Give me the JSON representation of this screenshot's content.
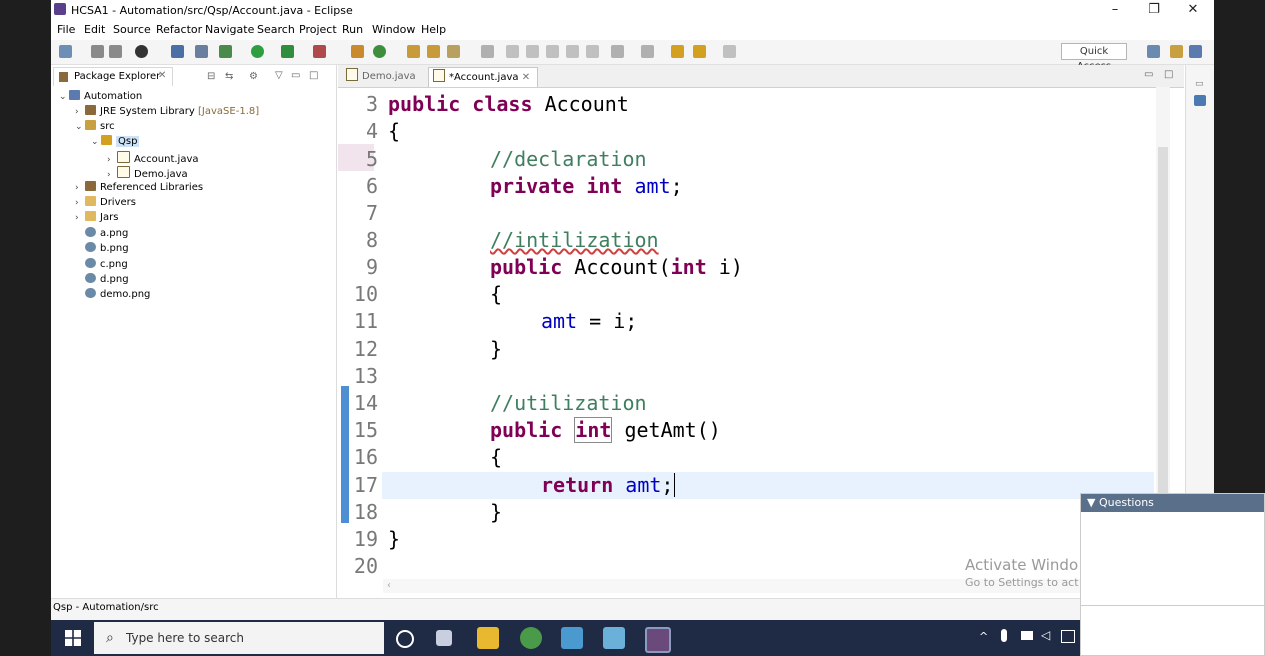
{
  "window": {
    "title": "HCSA1 - Automation/src/Qsp/Account.java - Eclipse",
    "controls": {
      "minimize": "–",
      "maximize": "❐",
      "close": "✕"
    }
  },
  "menu": [
    "File",
    "Edit",
    "Source",
    "Refactor",
    "Navigate",
    "Search",
    "Project",
    "Run",
    "Window",
    "Help"
  ],
  "toolbar": {
    "quick_access": "Quick Access"
  },
  "package_explorer": {
    "tab_label": "Package Explorer",
    "close": "✕",
    "tree": [
      {
        "label": "Automation",
        "deco": "",
        "arrow": "⌄"
      },
      {
        "label": "JRE System Library",
        "deco": "[JavaSE-1.8]",
        "arrow": "›"
      },
      {
        "label": "src",
        "deco": "",
        "arrow": "⌄"
      },
      {
        "label": "Qsp",
        "deco": "",
        "arrow": "⌄"
      },
      {
        "label": "Account.java",
        "deco": "",
        "arrow": "›"
      },
      {
        "label": "Demo.java",
        "deco": "",
        "arrow": "›"
      },
      {
        "label": "Referenced Libraries",
        "deco": "",
        "arrow": "›"
      },
      {
        "label": "Drivers",
        "deco": "",
        "arrow": "›"
      },
      {
        "label": "Jars",
        "deco": "",
        "arrow": "›"
      },
      {
        "label": "a.png",
        "deco": "",
        "arrow": ""
      },
      {
        "label": "b.png",
        "deco": "",
        "arrow": ""
      },
      {
        "label": "c.png",
        "deco": "",
        "arrow": ""
      },
      {
        "label": "d.png",
        "deco": "",
        "arrow": ""
      },
      {
        "label": "demo.png",
        "deco": "",
        "arrow": ""
      }
    ]
  },
  "editor": {
    "tabs": [
      {
        "label": "Demo.java",
        "active": false
      },
      {
        "label": "*Account.java",
        "active": true,
        "close": "✕"
      }
    ],
    "line_numbers": [
      "3",
      "4",
      "5",
      "6",
      "7",
      "8",
      "9",
      "10",
      "11",
      "12",
      "13",
      "14",
      "15",
      "16",
      "17",
      "18",
      "19",
      "20"
    ],
    "code": {
      "l3_kw1": "public",
      "l3_kw2": "class",
      "l3_name": "Account",
      "l4": "{",
      "l5": "//declaration",
      "l6_kw1": "private",
      "l6_kw2": "int",
      "l6_field": "amt",
      "l6_end": ";",
      "l8": "//intilization",
      "l9_kw1": "public",
      "l9_name": "Account(",
      "l9_kw2": "int",
      "l9_rest": " i)",
      "l10": "{",
      "l11_field": "amt",
      "l11_rest": " = i;",
      "l12": "}",
      "l14": "//utilization",
      "l15_kw1": "public",
      "l15_kw2": "int",
      "l15_rest": " getAmt()",
      "l16": "{",
      "l17_kw": "return",
      "l17_field": "amt",
      "l17_end": ";",
      "l18": "}",
      "l19": "}"
    }
  },
  "status": {
    "path": "Qsp - Automation/src"
  },
  "watermark": {
    "line1": "Activate Windo",
    "line2": "Go to Settings to act"
  },
  "questions_panel": {
    "title": "Questions",
    "arrow": "▼"
  },
  "taskbar": {
    "search_placeholder": "Type here to search"
  }
}
